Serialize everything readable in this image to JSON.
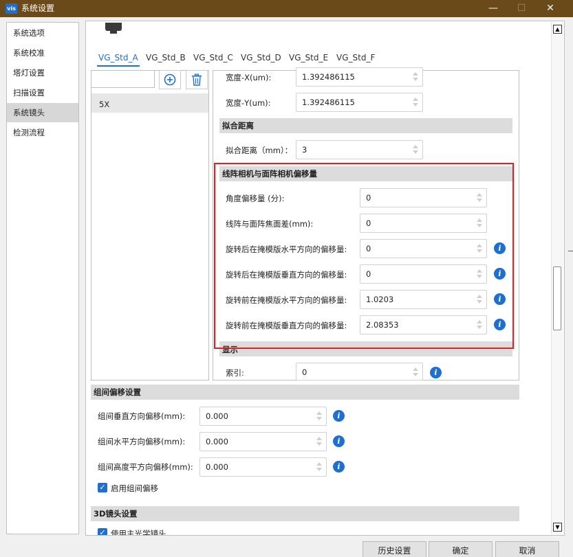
{
  "window": {
    "title": "系统设置",
    "app_icon_text": "vis",
    "minimize": "—",
    "maximize": "☐",
    "close": "✕"
  },
  "sidebar": {
    "items": [
      {
        "label": "系统选项"
      },
      {
        "label": "系统校准"
      },
      {
        "label": "塔灯设置"
      },
      {
        "label": "扫描设置"
      },
      {
        "label": "系统镜头",
        "selected": true
      },
      {
        "label": "检测流程"
      }
    ]
  },
  "tabs": [
    "VG_Std_A",
    "VG_Std_B",
    "VG_Std_C",
    "VG_Std_D",
    "VG_Std_E",
    "VG_Std_F"
  ],
  "lens_list": {
    "search_value": "",
    "items": [
      "5X"
    ]
  },
  "right_panel": {
    "width_x_label": "宽度-X(um):",
    "width_x_value": "1.392486115",
    "width_y_label": "宽度-Y(um):",
    "width_y_value": "1.392486115",
    "fit_section": "拟合距离",
    "fit_label": "拟合距离（mm）：",
    "fit_value": "3",
    "offset_section": "线阵相机与面阵相机偏移量",
    "offsets": [
      {
        "label": "角度偏移量 (分):",
        "value": "0"
      },
      {
        "label": "线阵与面阵焦面差(mm):",
        "value": "0"
      },
      {
        "label": "旋转后在掩模版水平方向的偏移量:",
        "value": "0"
      },
      {
        "label": "旋转后在掩模版垂直方向的偏移量:",
        "value": "0"
      },
      {
        "label": "旋转前在掩模版水平方向的偏移量:",
        "value": "1.0203"
      },
      {
        "label": "旋转前在掩模版垂直方向的偏移量:",
        "value": "2.08353"
      }
    ],
    "display_section": "显示",
    "index_label": "索引:",
    "index_value": "0"
  },
  "group_offset": {
    "section": "组间偏移设置",
    "vertical_label": "组间垂直方向偏移(mm):",
    "vertical_value": "0.000",
    "horizontal_label": "组间水平方向偏移(mm):",
    "horizontal_value": "0.000",
    "height_label": "组间高度平方向偏移(mm):",
    "height_value": "0.000",
    "enable_label": "启用组间偏移",
    "enable_checked": true
  },
  "lens3d": {
    "section": "3D镜头设置",
    "partial_label": "使用主光学镜头"
  },
  "footer": {
    "history": "历史设置",
    "ok": "确定",
    "cancel": "取消"
  },
  "colors": {
    "titlebar": "#6b4a1a",
    "accent": "#1e6fd0",
    "highlight_box": "#e02020"
  }
}
